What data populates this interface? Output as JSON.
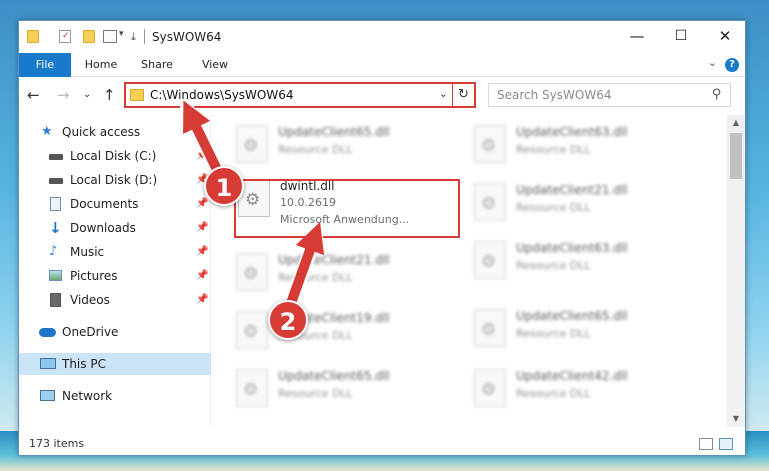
{
  "window": {
    "title": "SysWOW64",
    "minimize_glyph": "—",
    "maximize_glyph": "☐",
    "close_glyph": "✕"
  },
  "ribbon": {
    "tabs": [
      "File",
      "Home",
      "Share",
      "View"
    ],
    "help_glyph": "?",
    "expand_glyph": "⌄"
  },
  "nav": {
    "back_glyph": "←",
    "forward_glyph": "→",
    "recent_glyph": "⌄",
    "up_glyph": "↑",
    "address": "C:\\Windows\\SysWOW64",
    "address_dropdown_glyph": "⌄",
    "refresh_glyph": "↻",
    "search_placeholder": "Search SysWOW64",
    "search_glyph": "⚲"
  },
  "sidebar": {
    "items": [
      {
        "label": "Quick access",
        "icon": "star-icon",
        "pinned": false
      },
      {
        "label": "Local Disk (C:)",
        "icon": "drive-icon",
        "pinned": true
      },
      {
        "label": "Local Disk (D:)",
        "icon": "drive-icon",
        "pinned": true
      },
      {
        "label": "Documents",
        "icon": "documents-icon",
        "pinned": true
      },
      {
        "label": "Downloads",
        "icon": "download-icon",
        "pinned": true
      },
      {
        "label": "Music",
        "icon": "music-icon",
        "pinned": true
      },
      {
        "label": "Pictures",
        "icon": "pictures-icon",
        "pinned": true
      },
      {
        "label": "Videos",
        "icon": "videos-icon",
        "pinned": true
      },
      {
        "label": "OneDrive",
        "icon": "cloud-icon",
        "pinned": false
      },
      {
        "label": "This PC",
        "icon": "computer-icon",
        "pinned": false
      },
      {
        "label": "Network",
        "icon": "network-icon",
        "pinned": false
      }
    ],
    "pin_glyph": "📌"
  },
  "files": {
    "highlighted": {
      "name": "dwintl.dll",
      "version": "10.0.2619",
      "description": "Microsoft Anwendung..."
    },
    "left_column": [
      {
        "name": "UpdateClient65.dll",
        "type": "Resource DLL"
      },
      {
        "name": "UpdateClient21.dll",
        "type": "Resource DLL"
      },
      {
        "name": "UpdateClient19.dll",
        "type": "Resource DLL"
      },
      {
        "name": "UpdateClient65.dll",
        "type": "Resource DLL"
      }
    ],
    "right_column": [
      {
        "name": "UpdateClient63.dll",
        "type": "Resource DLL"
      },
      {
        "name": "UpdateClient21.dll",
        "type": "Resource DLL"
      },
      {
        "name": "UpdateClient63.dll",
        "type": "Resource DLL"
      },
      {
        "name": "UpdateClient65.dll",
        "type": "Resource DLL"
      },
      {
        "name": "UpdateClient42.dll",
        "type": "Resource DLL"
      }
    ],
    "gear_glyph": "⚙"
  },
  "scrollbar": {
    "up_glyph": "▲",
    "down_glyph": "▼"
  },
  "status": {
    "item_count": "173 items"
  },
  "annotations": {
    "step1": "1",
    "step2": "2"
  },
  "colors": {
    "accent": "#1979ca",
    "highlight": "#d63b35",
    "selected": "#cce4f7"
  }
}
